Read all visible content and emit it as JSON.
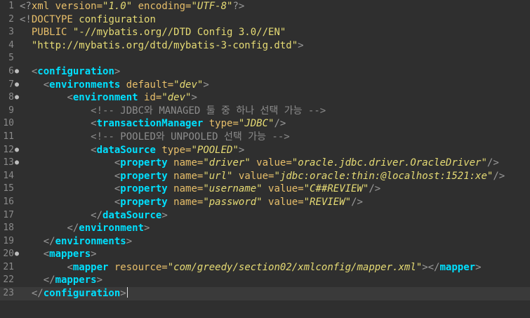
{
  "editor": {
    "lines": [
      {
        "n": "1",
        "fold": "",
        "indent": "",
        "t": [
          [
            "punc",
            "<?"
          ],
          [
            "decl",
            "xml"
          ],
          [
            "attr",
            " version="
          ],
          [
            "val",
            "\"1.0\""
          ],
          [
            "attr",
            " encoding="
          ],
          [
            "val",
            "\"UTF-8\""
          ],
          [
            "punc",
            "?>"
          ]
        ]
      },
      {
        "n": "2",
        "fold": "",
        "indent": "",
        "t": [
          [
            "punc",
            "<!"
          ],
          [
            "decl",
            "DOCTYPE"
          ],
          [
            "plain",
            " configuration"
          ]
        ]
      },
      {
        "n": "3",
        "fold": "",
        "indent": "  ",
        "t": [
          [
            "kw",
            "PUBLIC"
          ],
          [
            "plain",
            " \"-//mybatis.org//DTD Config 3.0//EN\""
          ]
        ]
      },
      {
        "n": "4",
        "fold": "",
        "indent": "  ",
        "t": [
          [
            "plain",
            "\"http://mybatis.org/dtd/mybatis-3-config.dtd\""
          ],
          [
            "punc",
            ">"
          ]
        ]
      },
      {
        "n": "5",
        "fold": "",
        "indent": "",
        "t": []
      },
      {
        "n": "6",
        "fold": "●",
        "indent": "  ",
        "t": [
          [
            "punc",
            "<"
          ],
          [
            "tag",
            "configuration"
          ],
          [
            "punc",
            ">"
          ]
        ]
      },
      {
        "n": "7",
        "fold": "●",
        "indent": "    ",
        "t": [
          [
            "punc",
            "<"
          ],
          [
            "tag",
            "environments"
          ],
          [
            "attr",
            " default="
          ],
          [
            "val",
            "\"dev\""
          ],
          [
            "punc",
            ">"
          ]
        ]
      },
      {
        "n": "8",
        "fold": "●",
        "indent": "        ",
        "t": [
          [
            "punc",
            "<"
          ],
          [
            "tag",
            "environment"
          ],
          [
            "attr",
            " id="
          ],
          [
            "val",
            "\"dev\""
          ],
          [
            "punc",
            ">"
          ]
        ]
      },
      {
        "n": "9",
        "fold": "",
        "indent": "            ",
        "t": [
          [
            "com",
            "<!-- JDBC와 MANAGED 둘 중 하나 선택 가능 -->"
          ]
        ]
      },
      {
        "n": "10",
        "fold": "",
        "indent": "            ",
        "t": [
          [
            "punc",
            "<"
          ],
          [
            "tag",
            "transactionManager"
          ],
          [
            "attr",
            " type="
          ],
          [
            "val",
            "\"JDBC\""
          ],
          [
            "punc",
            "/>"
          ]
        ]
      },
      {
        "n": "11",
        "fold": "",
        "indent": "            ",
        "t": [
          [
            "com",
            "<!-- POOLED와 UNPOOLED 선택 가능 -->"
          ]
        ]
      },
      {
        "n": "12",
        "fold": "●",
        "indent": "            ",
        "t": [
          [
            "punc",
            "<"
          ],
          [
            "tag",
            "dataSource"
          ],
          [
            "attr",
            " type="
          ],
          [
            "val",
            "\"POOLED\""
          ],
          [
            "punc",
            ">"
          ]
        ]
      },
      {
        "n": "13",
        "fold": "●",
        "indent": "                ",
        "t": [
          [
            "punc",
            "<"
          ],
          [
            "tag",
            "property"
          ],
          [
            "attr",
            " name="
          ],
          [
            "val",
            "\"driver\""
          ],
          [
            "attr",
            " value="
          ],
          [
            "val",
            "\"oracle.jdbc.driver.OracleDriver\""
          ],
          [
            "punc",
            "/>"
          ]
        ]
      },
      {
        "n": "14",
        "fold": "",
        "indent": "                ",
        "t": [
          [
            "punc",
            "<"
          ],
          [
            "tag",
            "property"
          ],
          [
            "attr",
            " name="
          ],
          [
            "val",
            "\"url\""
          ],
          [
            "attr",
            " value="
          ],
          [
            "val",
            "\"jdbc:oracle:thin:@localhost:1521:xe\""
          ],
          [
            "punc",
            "/>"
          ]
        ]
      },
      {
        "n": "15",
        "fold": "",
        "indent": "                ",
        "t": [
          [
            "punc",
            "<"
          ],
          [
            "tag",
            "property"
          ],
          [
            "attr",
            " name="
          ],
          [
            "val",
            "\"username\""
          ],
          [
            "attr",
            " value="
          ],
          [
            "val",
            "\"C##REVIEW\""
          ],
          [
            "punc",
            "/>"
          ]
        ]
      },
      {
        "n": "16",
        "fold": "",
        "indent": "                ",
        "t": [
          [
            "punc",
            "<"
          ],
          [
            "tag",
            "property"
          ],
          [
            "attr",
            " name="
          ],
          [
            "val",
            "\"password\""
          ],
          [
            "attr",
            " value="
          ],
          [
            "val",
            "\"REVIEW\""
          ],
          [
            "punc",
            "/>"
          ]
        ]
      },
      {
        "n": "17",
        "fold": "",
        "indent": "            ",
        "t": [
          [
            "punc",
            "</"
          ],
          [
            "tag",
            "dataSource"
          ],
          [
            "punc",
            ">"
          ]
        ]
      },
      {
        "n": "18",
        "fold": "",
        "indent": "        ",
        "t": [
          [
            "punc",
            "</"
          ],
          [
            "tag",
            "environment"
          ],
          [
            "punc",
            ">"
          ]
        ]
      },
      {
        "n": "19",
        "fold": "",
        "indent": "    ",
        "t": [
          [
            "punc",
            "</"
          ],
          [
            "tag",
            "environments"
          ],
          [
            "punc",
            ">"
          ]
        ]
      },
      {
        "n": "20",
        "fold": "●",
        "indent": "    ",
        "t": [
          [
            "punc",
            "<"
          ],
          [
            "tag",
            "mappers"
          ],
          [
            "punc",
            ">"
          ]
        ]
      },
      {
        "n": "21",
        "fold": "",
        "indent": "        ",
        "t": [
          [
            "punc",
            "<"
          ],
          [
            "tag",
            "mapper"
          ],
          [
            "attr",
            " resource="
          ],
          [
            "val",
            "\"com/greedy/section02/xmlconfig/mapper.xml\""
          ],
          [
            "punc",
            "></"
          ],
          [
            "tag",
            "mapper"
          ],
          [
            "punc",
            ">"
          ]
        ]
      },
      {
        "n": "22",
        "fold": "",
        "indent": "    ",
        "t": [
          [
            "punc",
            "</"
          ],
          [
            "tag",
            "mappers"
          ],
          [
            "punc",
            ">"
          ]
        ]
      },
      {
        "n": "23",
        "fold": "",
        "indent": "  ",
        "t": [
          [
            "punc",
            "</"
          ],
          [
            "tag",
            "configuration"
          ],
          [
            "punc",
            ">"
          ]
        ]
      }
    ],
    "current_line": "23",
    "colors": {
      "background": "#2f2f2f",
      "tag": "#00e0ff",
      "attribute": "#e8bf6a",
      "value": "#e6db74",
      "comment": "#8c8c8c"
    }
  }
}
